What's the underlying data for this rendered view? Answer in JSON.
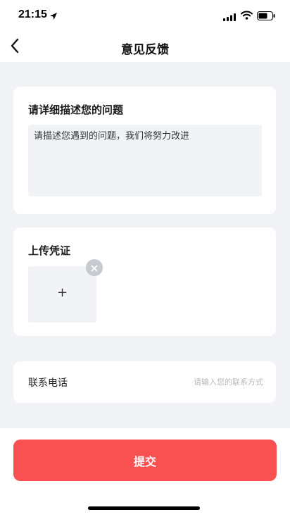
{
  "status_bar": {
    "time": "21:15",
    "icons": [
      "location-arrow-icon",
      "signal-icon",
      "wifi-icon",
      "battery-icon"
    ]
  },
  "nav": {
    "title": "意见反馈",
    "back_icon": "chevron-left-icon"
  },
  "feedback": {
    "heading": "请详细描述您的问题",
    "placeholder": "请描述您遇到的问题，我们将努力改进",
    "value": ""
  },
  "upload": {
    "heading": "上传凭证",
    "add_symbol": "+",
    "add_icon": "plus-icon",
    "remove_icon": "close-icon"
  },
  "contact": {
    "label": "联系电话",
    "placeholder": "请输入您的联系方式",
    "value": ""
  },
  "submit": {
    "label": "提交"
  },
  "colors": {
    "accent": "#f95152",
    "background": "#f2f3f7",
    "card": "#ffffff",
    "placeholder": "#b5b7bd"
  }
}
